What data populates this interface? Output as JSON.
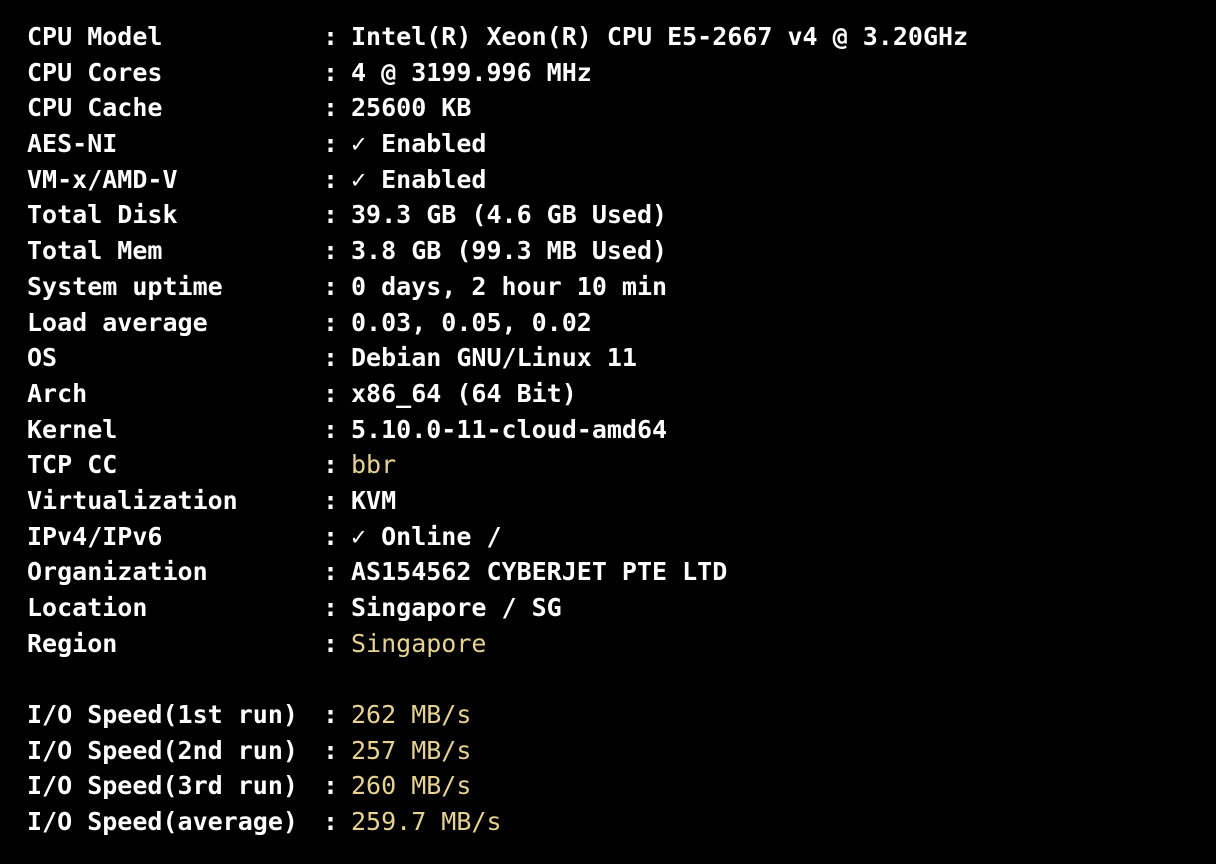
{
  "separator": ":",
  "system_info": [
    {
      "label": "CPU Model",
      "value": "Intel(R) Xeon(R) CPU E5-2667 v4 @ 3.20GHz"
    },
    {
      "label": "CPU Cores",
      "value": "4 @ 3199.996 MHz"
    },
    {
      "label": "CPU Cache",
      "value": "25600 KB"
    },
    {
      "label": "AES-NI",
      "value": "✓ Enabled"
    },
    {
      "label": "VM-x/AMD-V",
      "value": "✓ Enabled"
    },
    {
      "label": "Total Disk",
      "value": "39.3 GB (4.6 GB Used)"
    },
    {
      "label": "Total Mem",
      "value": "3.8 GB (99.3 MB Used)"
    },
    {
      "label": "System uptime",
      "value": "0 days, 2 hour 10 min"
    },
    {
      "label": "Load average",
      "value": "0.03, 0.05, 0.02"
    },
    {
      "label": "OS",
      "value": "Debian GNU/Linux 11"
    },
    {
      "label": "Arch",
      "value": "x86_64 (64 Bit)"
    },
    {
      "label": "Kernel",
      "value": "5.10.0-11-cloud-amd64"
    },
    {
      "label": "TCP CC",
      "value": "bbr"
    },
    {
      "label": "Virtualization",
      "value": "KVM"
    },
    {
      "label": "IPv4/IPv6",
      "value": "✓ Online /"
    },
    {
      "label": "Organization",
      "value": "AS154562 CYBERJET PTE LTD"
    },
    {
      "label": "Location",
      "value": "Singapore / SG"
    },
    {
      "label": "Region",
      "value": "Singapore"
    }
  ],
  "io_speed": [
    {
      "label": "I/O Speed(1st run)",
      "value": "262 MB/s"
    },
    {
      "label": "I/O Speed(2nd run)",
      "value": "257 MB/s"
    },
    {
      "label": "I/O Speed(3rd run)",
      "value": "260 MB/s"
    },
    {
      "label": "I/O Speed(average)",
      "value": "259.7 MB/s"
    }
  ],
  "colors": {
    "background": "#000000",
    "text": "#ffffff",
    "highlight": "#e8d290"
  }
}
